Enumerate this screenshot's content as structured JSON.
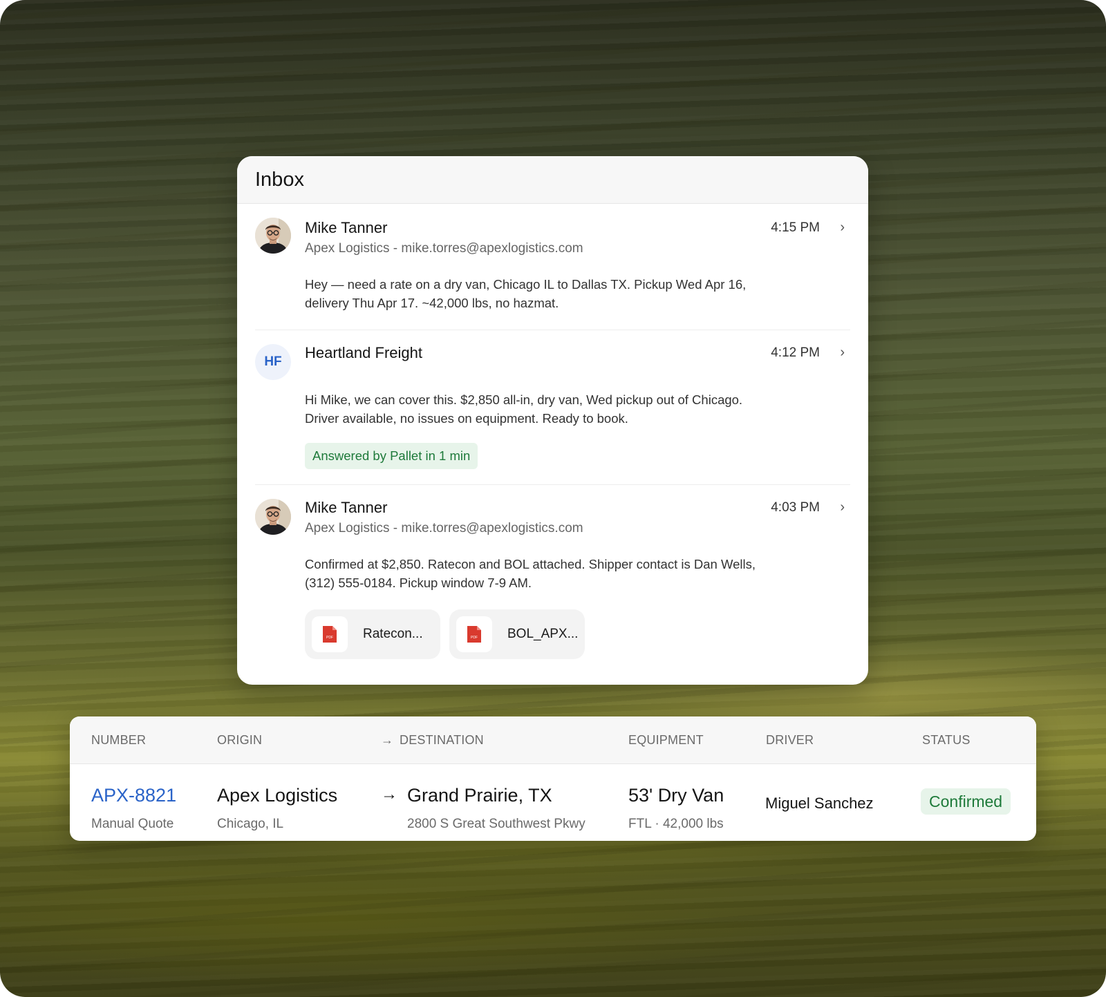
{
  "inbox": {
    "title": "Inbox",
    "messages": [
      {
        "sender": "Mike Tanner",
        "subline": "Apex Logistics - mike.torres@apexlogistics.com",
        "time": "4:15 PM",
        "body": "Hey — need a rate on a dry van, Chicago IL to Dallas TX. Pickup Wed Apr 16, delivery Thu Apr 17. ~42,000 lbs, no hazmat."
      },
      {
        "sender": "Heartland Freight",
        "initials": "HF",
        "time": "4:12 PM",
        "body": "Hi Mike, we can cover this. $2,850 all-in, dry van, Wed pickup out of Chicago. Driver available, no issues on equipment. Ready to book.",
        "badge": "Answered by Pallet in 1 min"
      },
      {
        "sender": "Mike Tanner",
        "subline": "Apex Logistics - mike.torres@apexlogistics.com",
        "time": "4:03 PM",
        "body": "Confirmed at $2,850. Ratecon and BOL attached. Shipper contact is Dan Wells, (312) 555-0184. Pickup window 7-9 AM.",
        "attachments": [
          {
            "label": "Ratecon...",
            "icon": "pdf-icon",
            "icon_text": "PDF"
          },
          {
            "label": "BOL_APX...",
            "icon": "pdf-icon",
            "icon_text": "PDF"
          }
        ]
      }
    ]
  },
  "loads_table": {
    "headers": {
      "number": "NUMBER",
      "origin": "ORIGIN",
      "destination": "DESTINATION",
      "equipment": "EQUIPMENT",
      "driver": "DRIVER",
      "status": "STATUS"
    },
    "row": {
      "number": "APX-8821",
      "number_sub": "Manual Quote",
      "origin": "Apex Logistics",
      "origin_sub": "Chicago, IL",
      "destination": "Grand Prairie, TX",
      "destination_sub": "2800 S Great Southwest Pkwy",
      "equipment": "53' Dry Van",
      "equipment_sub": "FTL · 42,000 lbs",
      "driver": "Miguel Sanchez",
      "status": "Confirmed"
    }
  },
  "colors": {
    "link": "#2a63c8",
    "success_bg": "#e7f4ea",
    "success_text": "#1e7a3a",
    "pdf_red": "#d93a2e"
  }
}
